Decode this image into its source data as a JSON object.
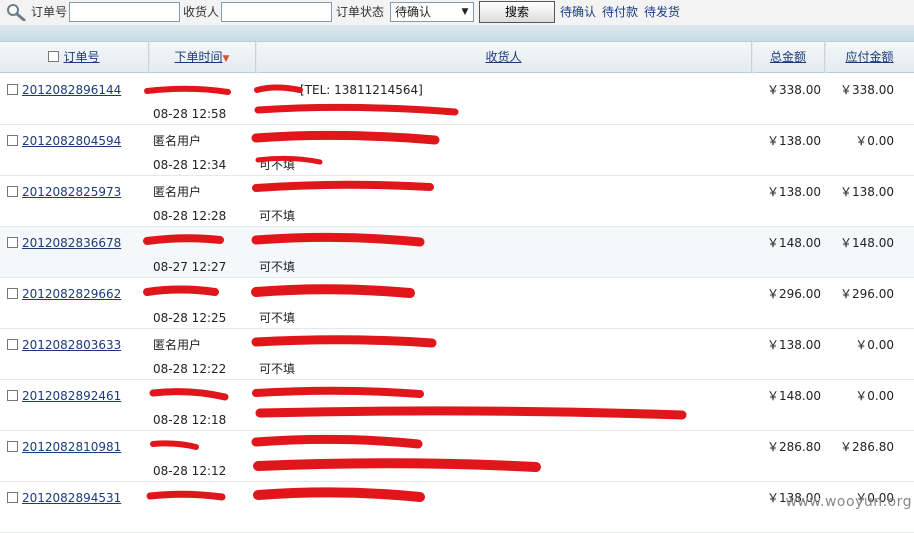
{
  "toolbar": {
    "order_no_label": "订单号",
    "order_no_value": "",
    "receiver_label": "收货人",
    "receiver_value": "",
    "status_label": "订单状态",
    "status_selected": "待确认",
    "search_button": "搜索",
    "quick_links": [
      "待确认",
      "待付款",
      "待发货"
    ]
  },
  "table": {
    "headers": {
      "order_no": "订单号",
      "order_time": "下单时间",
      "receiver": "收货人",
      "total": "总金额",
      "payable": "应付金额"
    },
    "rows": [
      {
        "order_no": "2012082896144",
        "buyer": "",
        "time": "08-28 12:58",
        "receiver_line1": "[TEL: 13811214564]",
        "receiver_line2": "",
        "total": "￥338.00",
        "payable": "￥338.00"
      },
      {
        "order_no": "2012082804594",
        "buyer": "匿名用户",
        "time": "08-28 12:34",
        "receiver_line1": "",
        "receiver_line2": "可不填",
        "total": "￥138.00",
        "payable": "￥0.00"
      },
      {
        "order_no": "2012082825973",
        "buyer": "匿名用户",
        "time": "08-28 12:28",
        "receiver_line1": "",
        "receiver_line2": "可不填",
        "total": "￥138.00",
        "payable": "￥138.00"
      },
      {
        "order_no": "2012082836678",
        "buyer": "",
        "time": "08-27 12:27",
        "receiver_line1": "",
        "receiver_line2": "可不填",
        "total": "￥148.00",
        "payable": "￥148.00"
      },
      {
        "order_no": "2012082829662",
        "buyer": "",
        "time": "08-28 12:25",
        "receiver_line1": "",
        "receiver_line2": "可不填",
        "total": "￥296.00",
        "payable": "￥296.00"
      },
      {
        "order_no": "2012082803633",
        "buyer": "匿名用户",
        "time": "08-28 12:22",
        "receiver_line1": "",
        "receiver_line2": "可不填",
        "total": "￥138.00",
        "payable": "￥0.00"
      },
      {
        "order_no": "2012082892461",
        "buyer": "",
        "time": "08-28 12:18",
        "receiver_line1": "",
        "receiver_line2": "",
        "total": "￥148.00",
        "payable": "￥0.00"
      },
      {
        "order_no": "2012082810981",
        "buyer": "",
        "time": "08-28 12:12",
        "receiver_line1": "",
        "receiver_line2": "",
        "total": "￥286.80",
        "payable": "￥286.80"
      },
      {
        "order_no": "2012082894531",
        "buyer": "",
        "time": "",
        "receiver_line1": "",
        "receiver_line2": "",
        "total": "￥138.00",
        "payable": "￥0.00"
      }
    ]
  },
  "watermark": "www.wooyun.org",
  "colors": {
    "link": "#1b3a7a",
    "redaction": "#e0161b",
    "header_bg": "#e3ebef"
  },
  "icons": {
    "search": "magnifier-icon",
    "sort": "sort-desc-icon",
    "dropdown": "chevron-down-icon"
  }
}
